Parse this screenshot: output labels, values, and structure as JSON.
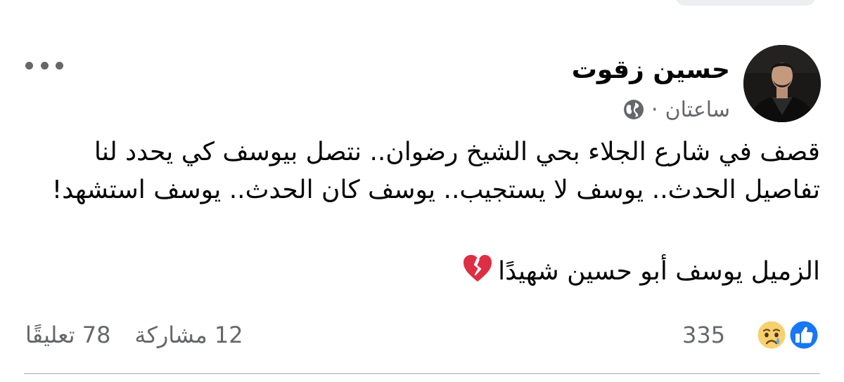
{
  "post": {
    "author": "حسين زقوت",
    "time": "ساعتان",
    "separator": "·",
    "body_lines": [
      "قصف في شارع الجلاء بحي الشيخ رضوان.. نتصل بيوسف كي يحدد لنا",
      "تفاصيل الحدث.. يوسف لا يستجيب.. يوسف كان الحدث.. يوسف استشهد!"
    ],
    "caption": "الزميل يوسف أبو حسين شهيدًا",
    "caption_emoji": "broken-heart-icon"
  },
  "reactions": {
    "count": "335",
    "types": [
      "like-icon",
      "sad-icon"
    ]
  },
  "stats": {
    "comments": "78 تعليقًا",
    "shares": "12 مشاركة"
  },
  "icons": {
    "privacy": "globe-icon",
    "menu": "more-options-icon"
  },
  "colors": {
    "text": "#050505",
    "secondary": "#65676b",
    "like_blue": "#1877f2",
    "heart_red": "#e0245e",
    "divider": "#ced0d4"
  }
}
